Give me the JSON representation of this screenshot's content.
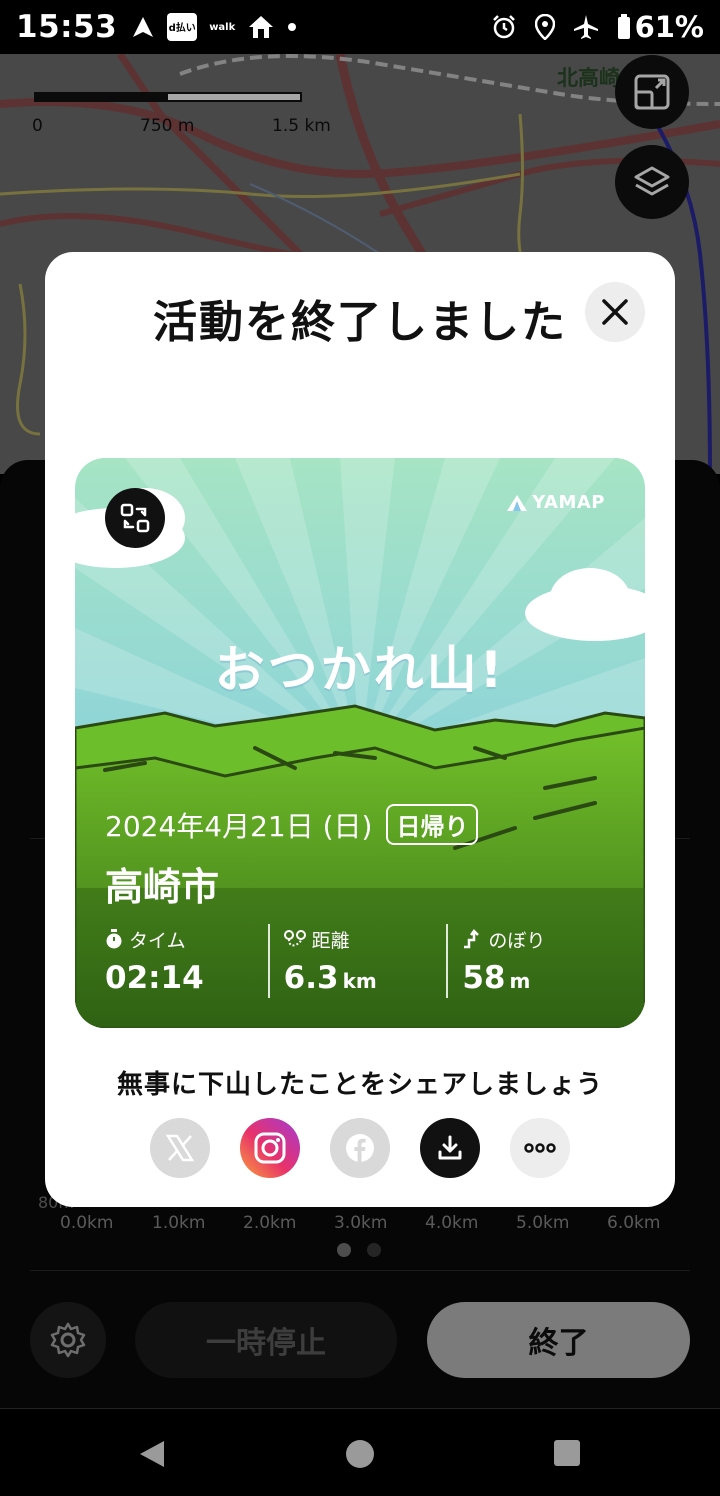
{
  "status_bar": {
    "time": "15:53",
    "dpay_label": "d払い",
    "walk_label": "walk",
    "battery": "61%"
  },
  "map": {
    "scale_start": "0",
    "scale_mid": "750 m",
    "scale_end": "1.5 km",
    "place_label": "北高崎"
  },
  "panel": {
    "y_axis_bottom": "80m",
    "x_axis": [
      "0.0km",
      "1.0km",
      "2.0km",
      "3.0km",
      "4.0km",
      "5.0km",
      "6.0km"
    ],
    "settings_icon": "gear-icon",
    "pause_label": "一時停止",
    "end_label": "終了"
  },
  "modal": {
    "title": "活動を終了しました",
    "card": {
      "brand": "YAMAP",
      "headline": "おつかれ山!",
      "date": "2024年4月21日 (日)",
      "trip_type": "日帰り",
      "place": "高崎市",
      "stats": [
        {
          "label": "タイム",
          "value": "02:14",
          "unit": "",
          "icon": "stopwatch-icon"
        },
        {
          "label": "距離",
          "value": "6.3",
          "unit": "km",
          "icon": "route-icon"
        },
        {
          "label": "のぼり",
          "value": "58",
          "unit": "m",
          "icon": "ascent-icon"
        }
      ]
    },
    "share_text": "無事に下山したことをシェアしましょう",
    "share_buttons": [
      "x-icon",
      "instagram-icon",
      "facebook-icon",
      "download-icon",
      "more-icon"
    ],
    "colors": {
      "sky_top": "#a8e6c8",
      "sky_bottom": "#7ac7ea",
      "hill_light": "#7cc92c",
      "hill_dark": "#3d7a18",
      "instagram": "#d6249f"
    }
  }
}
